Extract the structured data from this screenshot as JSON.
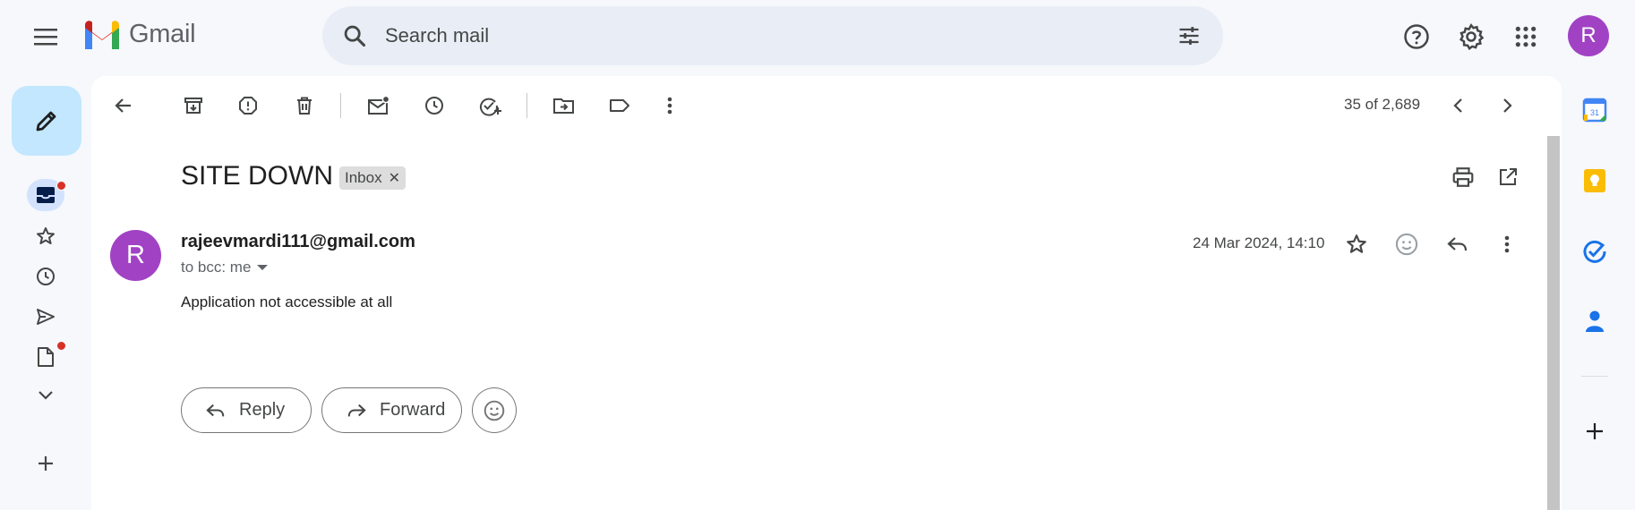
{
  "app": {
    "logo_text": "Gmail"
  },
  "search": {
    "placeholder": "Search mail"
  },
  "account": {
    "initial": "R",
    "color": "#a142c4"
  },
  "toolbar": {
    "count": "35 of 2,689"
  },
  "email": {
    "subject": "SITE DOWN",
    "label": "Inbox",
    "sender_initial": "R",
    "sender": "rajeevmardi111@gmail.com",
    "to": "to bcc: me",
    "date": "24 Mar 2024, 14:10",
    "body": "Application not accessible at all"
  },
  "actions": {
    "reply": "Reply",
    "forward": "Forward"
  },
  "side_panel": {
    "calendar_day": "31"
  },
  "colors": {
    "compose_bg": "#c2e7ff",
    "search_bg": "#e9eef6",
    "accent": "#0b57d0",
    "unread_dot": "#d93025"
  }
}
